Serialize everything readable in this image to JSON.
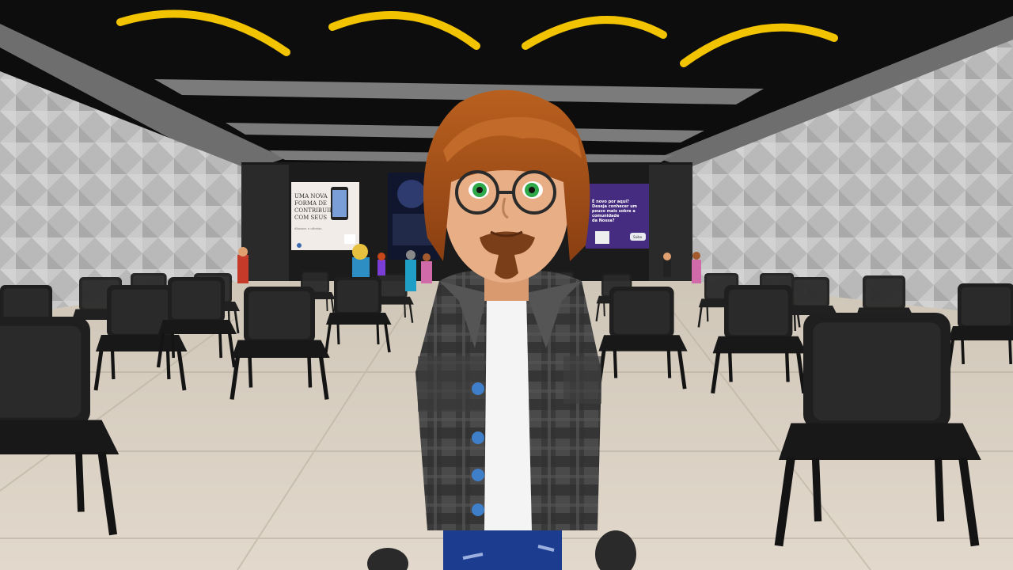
{
  "scene": {
    "type": "virtual-event-hall",
    "view": "first-person"
  },
  "screens": {
    "left": {
      "headline_lines": [
        "UMA NOVA",
        "FORMA DE",
        "CONTRIBUIR",
        "COM SEUS"
      ],
      "subline": "dízimos e ofertas"
    },
    "right": {
      "headline_lines": [
        "É novo por aqui?",
        "Deseja conhecer um",
        "pouco mais sobre a",
        "comunidade",
        "da Nossa?"
      ],
      "button_label": "Saiba"
    }
  },
  "colors": {
    "ceiling_light": "#f2c300",
    "chair": "#1f1f1f",
    "floor": "#d8cfc1",
    "wall": "#bdbdbd",
    "hair": "#a34f17",
    "jacket": "#3d3d3d",
    "shirt": "#f4f4f4",
    "jeans": "#1c3d8f",
    "eyes": "#2fa84a",
    "button": "#3f7ec9"
  },
  "icons": [
    "ceiling-light-icon",
    "qr-code-icon",
    "phone-icon"
  ]
}
